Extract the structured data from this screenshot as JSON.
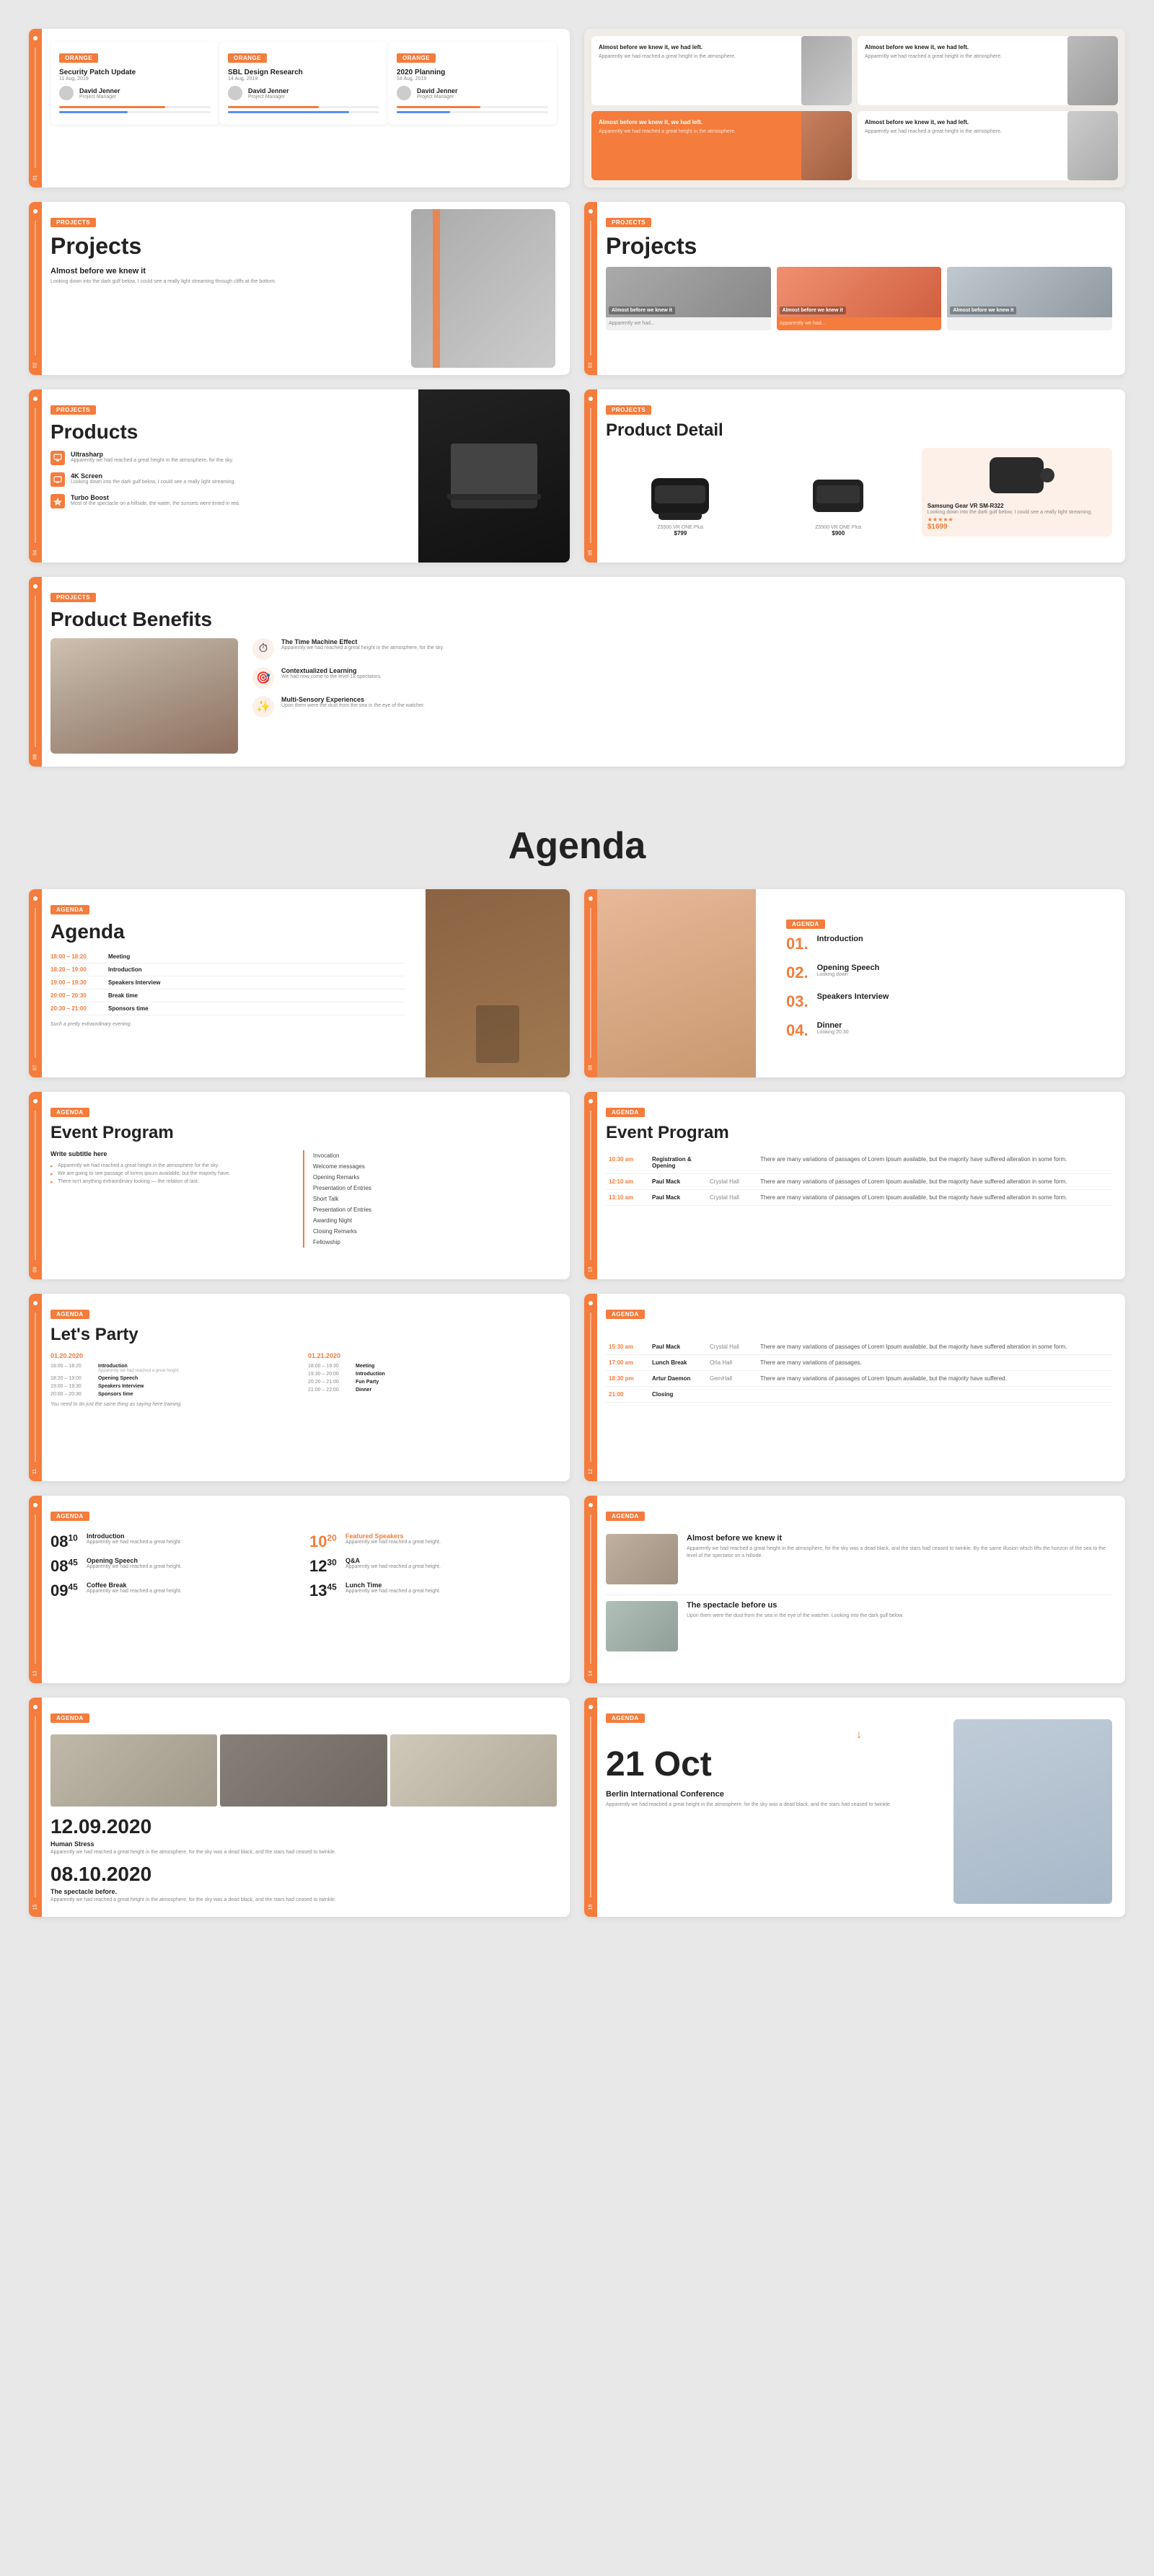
{
  "colors": {
    "orange": "#f47c3c",
    "white": "#ffffff",
    "bg": "#e8e8e8",
    "dark": "#222222",
    "gray": "#888888",
    "lightgray": "#f0f0f0"
  },
  "row1": {
    "cards": [
      {
        "tag": "ORANGE",
        "title": "Security Patch Update",
        "date": "11 Aug, 2019",
        "person_name": "David Jenner",
        "person_role": "Project Manager",
        "progress1": 70,
        "progress2": 45
      },
      {
        "tag": "ORANGE",
        "title": "SBL Design Research",
        "date": "14 Aug, 2019",
        "person_name": "David Jenner",
        "person_role": "Project Manager",
        "progress1": 60,
        "progress2": 80
      },
      {
        "tag": "ORANGE",
        "title": "2020 Planning",
        "date": "18 Aug, 2019",
        "person_name": "David Jenner",
        "person_role": "Project Manager",
        "progress1": 55,
        "progress2": 35
      }
    ]
  },
  "row1right": {
    "slides": [
      {
        "label": "Almost before we knew it, we had left.",
        "sub": "Apparently we had reached a great height in the atmosphere."
      },
      {
        "label": "Almost before we knew it, we had left.",
        "sub": "Apparently we had reached a great height in the atmosphere."
      },
      {
        "label": "Almost before we knew it, we had left.",
        "sub": "Apparently we had reached a great height in the atmosphere."
      },
      {
        "label": "Almost before we knew it, we had left.",
        "sub": "Apparently we had reached a great height in the atmosphere."
      }
    ]
  },
  "projects_slide1": {
    "tag": "PROJECTS",
    "title": "Projects",
    "subtitle": "Almost before we knew it",
    "body": "Looking down into the dark gulf below, I could see a really light streaming through cliffs at the bottom."
  },
  "projects_slide2": {
    "tag": "PROJECTS",
    "title": "Projects",
    "boxes": [
      {
        "label": "Almost before we knew it",
        "sub": "Apparently we had..."
      },
      {
        "label": "Almost before we knew it",
        "sub": "Apparently we had...",
        "highlight": true
      },
      {
        "label": "Almost before we knew it",
        "sub": ""
      }
    ]
  },
  "products_slide": {
    "tag": "PROJECTS",
    "title": "Products",
    "items": [
      {
        "name": "Ultrasharp",
        "desc": "Apparently we had reached a great height in the atmosphere, for the sky."
      },
      {
        "name": "4K Screen",
        "desc": "Looking down into the dark gulf below, I could see a really light streaming."
      },
      {
        "name": "Turbo Boost",
        "desc": "Most of the spectacle on a hillside, the water, the sunsets were tinted in red."
      }
    ]
  },
  "product_detail": {
    "tag": "PROJECTS",
    "title": "Product Detail",
    "products": [
      {
        "name": "Z5500 VR ONE Plus",
        "price": "$799",
        "old_price": "",
        "rating": 0
      },
      {
        "name": "Z5500 VR ONE Plus",
        "price": "$900",
        "old_price": "",
        "rating": 0
      },
      {
        "name": "Samsung Gear VR SM-R322",
        "price": "$1699",
        "old_price": "",
        "rating": 5,
        "highlight": true,
        "desc": "Looking down into the dark gulf below, I could see a really light streaming."
      }
    ]
  },
  "product_benefits": {
    "tag": "PROJECTS",
    "title": "Product Benefits",
    "benefits": [
      {
        "icon": "⏱",
        "title": "The Time Machine Effect",
        "desc": "Apparently we had reached a great height in the atmosphere, for the sky."
      },
      {
        "icon": "🎯",
        "title": "Contextualized Learning",
        "desc": "We had now come to the level 1k spectators."
      },
      {
        "icon": "✨",
        "title": "Multi-Sensory Experiences",
        "desc": "Upon them were the dust from the sea in the eye of the watcher."
      }
    ]
  },
  "agenda_title": "Agenda",
  "agenda_slide1": {
    "tag": "AGENDA",
    "title": "Agenda",
    "schedule": [
      {
        "time": "18:00 – 18:20",
        "event": "Meeting"
      },
      {
        "time": "18:20 – 19:00",
        "event": "Introduction"
      },
      {
        "time": "19:00 – 19:30",
        "event": "Speakers Interview"
      },
      {
        "time": "20:00 – 20:30",
        "event": "Break time"
      },
      {
        "time": "20:30 – 21:00",
        "event": "Sponsors time"
      }
    ],
    "footer": "Such a pretty extraordinary evening."
  },
  "agenda_slide2": {
    "tag": "AGENDA",
    "items": [
      {
        "num": "01.",
        "title": "Introduction",
        "sub": ""
      },
      {
        "num": "02.",
        "title": "Opening Speech",
        "sub": "Looking down"
      },
      {
        "num": "03.",
        "title": "Speakers Interview",
        "sub": ""
      },
      {
        "num": "04.",
        "title": "Dinner",
        "sub": "Looking 20:30"
      }
    ]
  },
  "event_program1": {
    "tag": "AGENDA",
    "title": "Event Program",
    "subtitle": "Write subtitle here",
    "list": [
      "Invocation",
      "Welcome messages",
      "Opening Remarks",
      "Presentation of Entries",
      "Short Talk",
      "Presentation of Entries",
      "Awarding Night",
      "Closing Remarks",
      "Fellowship"
    ],
    "bullets": [
      "Apparently we had reached a great height in the atmosphere for the sky.",
      "We are going to see passage of lorem ipsum available, but the majority have.",
      "There isn't anything extraordinary looking — the relation of last."
    ]
  },
  "event_program2": {
    "tag": "AGENDA",
    "title": "Event Program",
    "rows": [
      {
        "time": "10:30 am",
        "speaker": "",
        "hall": "",
        "event": "Registration & Opening",
        "desc": "There are many variations of passages of Lorem Ipsum available, but the majority have suffered alteration in some form."
      },
      {
        "time": "12:10 am",
        "speaker": "Paul Mack",
        "hall": "Crystal Hall",
        "event": "",
        "desc": "There are many variations of passages of Lorem Ipsum available, but the majority have suffered alteration in some form."
      },
      {
        "time": "13:10 am",
        "speaker": "Paul Mack",
        "hall": "Crystal Hall",
        "event": "",
        "desc": "There are many variations of passages of Lorem Ipsum available, but the majority have suffered alteration in some form."
      }
    ]
  },
  "lets_party": {
    "tag": "AGENDA",
    "title": "Let's Party",
    "col1_date": "01.20.2020",
    "col2_date": "01.21.2020",
    "col1": [
      {
        "time": "18:00 – 18:20",
        "name": "Introduction",
        "desc": "Apparently we had reached a great height."
      },
      {
        "time": "18:20 – 19:00",
        "name": "Opening Speech"
      },
      {
        "time": "19:00 – 19:30",
        "name": "Speakers Interview"
      },
      {
        "time": "20:00 – 20:30",
        "name": "Sponsors time"
      }
    ],
    "col2": [
      {
        "time": "18:00 – 19:30",
        "name": "Meeting"
      },
      {
        "time": "19:30 – 20:00",
        "name": "Introduction"
      },
      {
        "time": "20:20 – 21:00",
        "name": "Fun Party"
      },
      {
        "time": "21:00 – 22:00",
        "name": "Dinner"
      }
    ],
    "footer": "You need to do just the same thing as saying here training."
  },
  "event_program3_rows": [
    {
      "time": "15:30 am",
      "speaker": "Paul Mack",
      "hall": "Crystal Hall",
      "desc": "There are many variations of passages of Lorem Ipsum available, but the majority have suffered alteration in some form."
    },
    {
      "time": "17:00 am",
      "speaker": "Lunch Break",
      "hall": "Orla Hall",
      "desc": "There are many variations of passages."
    },
    {
      "time": "18:30 pm",
      "speaker": "Artur Daemon",
      "hall": "GemHall",
      "desc": "There are many variations of passages of Lorem Ipsum available, but the majority have suffered."
    },
    {
      "time": "21:00",
      "speaker": "Closing",
      "hall": "",
      "desc": ""
    }
  ],
  "schedule_numbered": {
    "tag": "AGENDA",
    "col1": [
      {
        "num": "08",
        "sup": "10",
        "label": "Introduction",
        "sub": "Apparently we had reached a great height."
      },
      {
        "num": "08",
        "sup": "45",
        "label": "Opening Speech",
        "sub": "Apparently we had reached a great height."
      },
      {
        "num": "09",
        "sup": "45",
        "label": "Coffee Break",
        "sub": "Apparently we had reached a great height."
      }
    ],
    "col2": [
      {
        "num": "10",
        "sup": "20",
        "label": "Featured Speakers",
        "sub": "Apparently we had reached a great height.",
        "orange": true
      },
      {
        "num": "12",
        "sup": "30",
        "label": "Q&A",
        "sub": "Apparently we had reached a great height."
      },
      {
        "num": "13",
        "sup": "45",
        "label": "Lunch Time",
        "sub": "Apparently we had reached a great height."
      }
    ]
  },
  "articles": {
    "tag": "AGENDA",
    "items": [
      {
        "title": "Almost before we knew it",
        "body": "Apparently we had reached a great height in the atmosphere, for the sky was a dead black, and the stars had ceased to twinkle. By the same illusion which lifts the horizon of the sea to the level of the spectator on a hillside."
      },
      {
        "title": "The spectacle before us",
        "body": "Upon them were the dust from the sea in the eye of the watcher. Looking into the dark gulf below."
      }
    ]
  },
  "date_slides": {
    "left": {
      "tag": "AGENDA",
      "date1": "12.09.2020",
      "event1": "Human Stress",
      "date2": "08.10.2020",
      "event2": "The spectacle before."
    },
    "right": {
      "tag": "AGENDA",
      "date": "21 Oct",
      "title": "Berlin International Conference",
      "body": "Apparently we had reached a great height in the atmosphere, for the sky was a dead black, and the stars had ceased to twinkle."
    }
  }
}
